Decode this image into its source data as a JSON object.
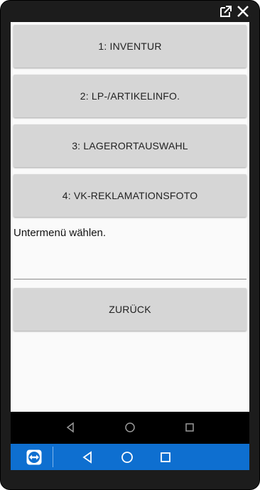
{
  "window": {
    "popout_icon": "external-link-icon",
    "close_icon": "close-icon"
  },
  "menu": {
    "items": [
      {
        "label": "1: INVENTUR"
      },
      {
        "label": "2: LP-/ARTIKELINFO."
      },
      {
        "label": "3: LAGERORTAUSWAHL"
      },
      {
        "label": "4: VK-REKLAMATIONSFOTO"
      }
    ],
    "hint": "Untermenü wählen.",
    "back_label": "ZURÜCK"
  },
  "android_nav": {
    "icons": [
      "back-triangle-icon",
      "home-circle-icon",
      "recents-square-icon"
    ]
  },
  "teamviewer_bar": {
    "color": "#0e6fd0",
    "icons": [
      "teamviewer-logo-icon",
      "back-triangle-icon",
      "home-circle-icon",
      "recents-square-icon"
    ]
  }
}
